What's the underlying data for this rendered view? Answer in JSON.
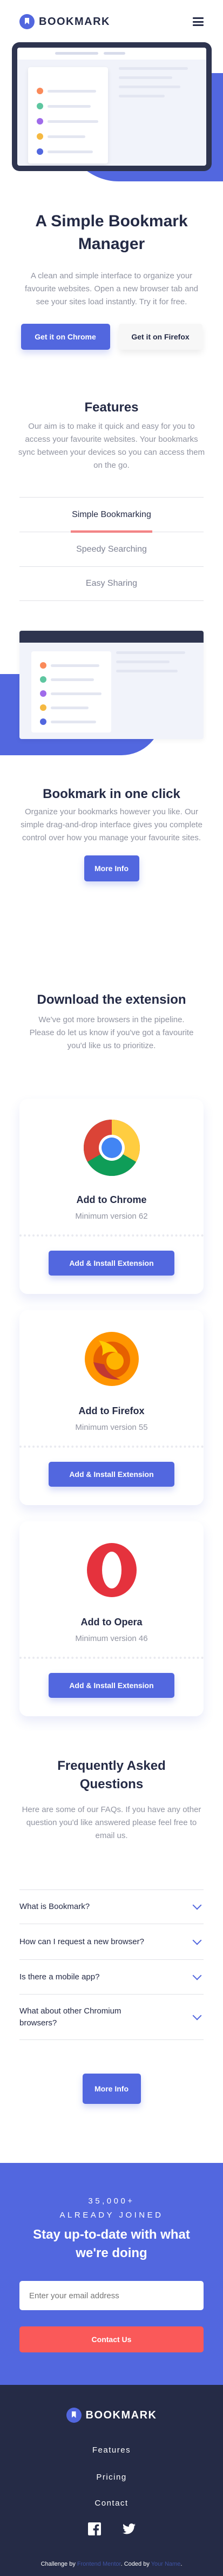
{
  "brand": {
    "name": "BOOKMARK"
  },
  "hero": {
    "title": "A Simple Bookmark Manager",
    "text": "A clean and simple interface to organize your favourite websites. Open a new browser tab and see your sites load instantly. Try it for free.",
    "cta_primary": "Get it on Chrome",
    "cta_secondary": "Get it on Firefox"
  },
  "features": {
    "title": "Features",
    "text": "Our aim is to make it quick and easy for you to access your favourite websites. Your bookmarks sync between your devices so you can access them on the go.",
    "tabs": [
      "Simple Bookmarking",
      "Speedy Searching",
      "Easy Sharing"
    ],
    "active_tab": "Simple Bookmarking",
    "panel_title": "Bookmark in one click",
    "panel_text": "Organize your bookmarks however you like. Our simple drag-and-drop interface gives you complete control over how you manage your favourite sites.",
    "panel_button": "More Info"
  },
  "download": {
    "title": "Download the extension",
    "text": "We've got more browsers in the pipeline. Please do let us know if you've got a favourite you'd like us to prioritize.",
    "cards": [
      {
        "title": "Add to Chrome",
        "min": "Minimum version 62",
        "button": "Add & Install Extension",
        "icon": "chrome-icon"
      },
      {
        "title": "Add to Firefox",
        "min": "Minimum version 55",
        "button": "Add & Install Extension",
        "icon": "firefox-icon"
      },
      {
        "title": "Add to Opera",
        "min": "Minimum version 46",
        "button": "Add & Install Extension",
        "icon": "opera-icon"
      }
    ]
  },
  "faq": {
    "title": "Frequently Asked Questions",
    "text": "Here are some of our FAQs. If you have any other question you'd like answered please feel free to email us.",
    "items": [
      "What is Bookmark?",
      "How can I request a new browser?",
      "Is there a mobile app?",
      "What about other Chromium browsers?"
    ],
    "button": "More Info"
  },
  "newsletter": {
    "kicker": "35,000+ ALREADY JOINED",
    "title": "Stay up-to-date with what we're doing",
    "placeholder": "Enter your email address",
    "button": "Contact Us"
  },
  "footer": {
    "links": [
      "Features",
      "Pricing",
      "Contact"
    ],
    "socials": [
      "facebook-icon",
      "twitter-icon"
    ],
    "challenge_label": "Challenge by",
    "challenge_link": "Frontend Mentor",
    "coded_label": "Coded by",
    "coded_link": "Your Name"
  },
  "colors": {
    "primary": "#5267DF",
    "accent": "#FA5959",
    "dark": "#242A45",
    "footer": "#252B46",
    "muted": "#9194A1"
  }
}
